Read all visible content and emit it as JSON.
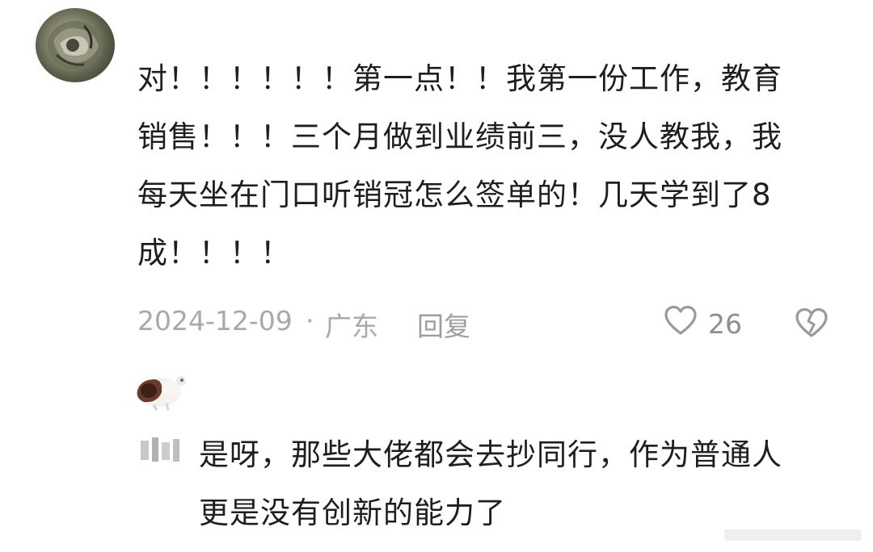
{
  "comment": {
    "text_lines": [
      "对！！！！！！第一点！！我第一份工作，教育",
      "销售！！！三个月做到业绩前三，没人教我，我",
      "每天坐在门口听销冠怎么签单的！几天学到了8",
      "成！！！！"
    ],
    "date": "2024-12-09",
    "separator": "·",
    "location": "广东",
    "reply_label": "回复",
    "like_count": "26",
    "icons": [
      "heart-outline-icon",
      "broken-heart-icon"
    ]
  },
  "reply": {
    "text_lines": [
      "是呀，那些大佬都会去抄同行，作为普通人",
      "更是没有创新的能力了"
    ]
  }
}
